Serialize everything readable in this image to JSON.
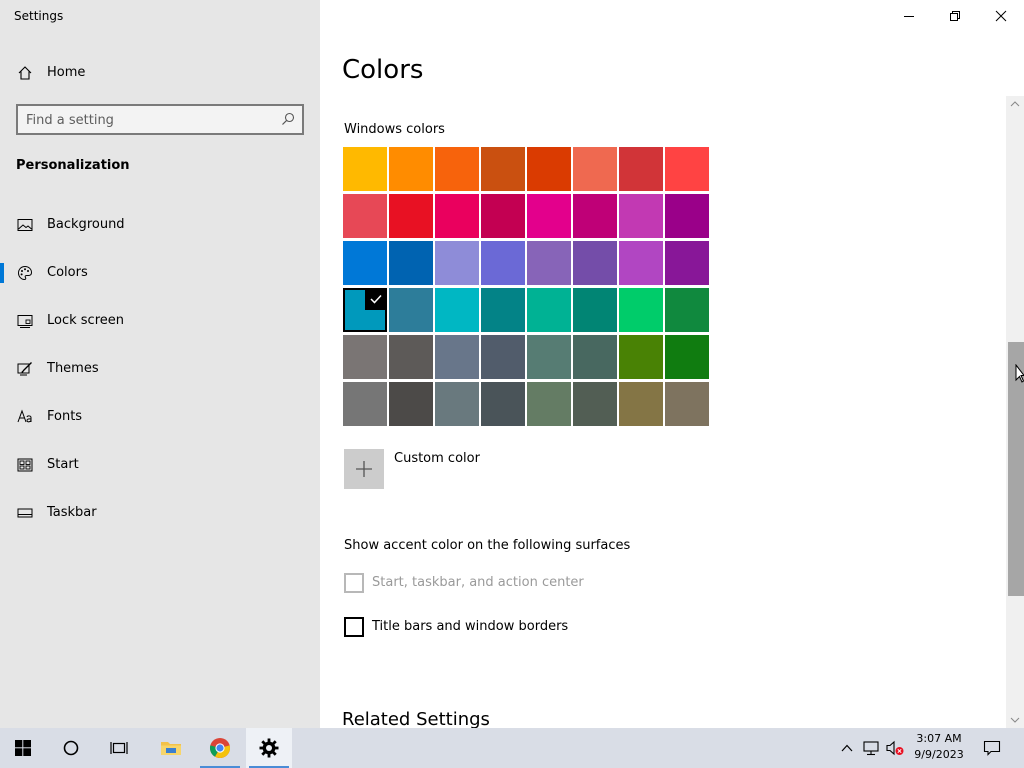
{
  "window": {
    "title": "Settings",
    "controls": [
      "minimize-icon",
      "restore-icon",
      "close-icon"
    ]
  },
  "sidebar": {
    "home_label": "Home",
    "search_placeholder": "Find a setting",
    "section_title": "Personalization",
    "items": [
      {
        "label": "Background",
        "icon": "image-icon"
      },
      {
        "label": "Colors",
        "icon": "palette-icon",
        "active": true
      },
      {
        "label": "Lock screen",
        "icon": "lock-screen-icon"
      },
      {
        "label": "Themes",
        "icon": "themes-icon"
      },
      {
        "label": "Fonts",
        "icon": "fonts-icon"
      },
      {
        "label": "Start",
        "icon": "start-icon"
      },
      {
        "label": "Taskbar",
        "icon": "taskbar-icon"
      }
    ]
  },
  "main": {
    "title": "Colors",
    "windows_colors_label": "Windows colors",
    "palette": [
      [
        "#FFB900",
        "#FF8C00",
        "#F7630C",
        "#CA5010",
        "#DA3B01",
        "#EF6950",
        "#D13438",
        "#FF4343"
      ],
      [
        "#E74856",
        "#E81123",
        "#EA005E",
        "#C30052",
        "#E3008C",
        "#BF0077",
        "#C239B3",
        "#9A0089"
      ],
      [
        "#0078D7",
        "#0063B1",
        "#8E8CD8",
        "#6B69D6",
        "#8764B8",
        "#744DA9",
        "#B146C2",
        "#881798"
      ],
      [
        "#0099BC",
        "#2D7D9A",
        "#00B7C3",
        "#038387",
        "#00B294",
        "#018574",
        "#00CC6A",
        "#10893E"
      ],
      [
        "#7A7574",
        "#5D5A58",
        "#68768A",
        "#515C6B",
        "#567C73",
        "#486860",
        "#498205",
        "#107C10"
      ],
      [
        "#767676",
        "#4C4A48",
        "#69797E",
        "#4A5459",
        "#647C64",
        "#525E54",
        "#847545",
        "#7E735F"
      ]
    ],
    "selected_color": {
      "row": 3,
      "col": 0
    },
    "custom_color_label": "Custom color",
    "accent_heading": "Show accent color on the following surfaces",
    "checkboxes": [
      {
        "label": "Start, taskbar, and action center",
        "checked": false,
        "disabled": true
      },
      {
        "label": "Title bars and window borders",
        "checked": false,
        "disabled": false
      }
    ],
    "related_heading": "Related Settings"
  },
  "taskbar": {
    "buttons": [
      "windows-start-icon",
      "cortana-search-icon",
      "task-view-icon",
      "file-explorer-icon",
      "chrome-icon",
      "settings-gear-icon"
    ],
    "active_button": "settings-gear-icon",
    "tray": [
      "chevron-up-icon",
      "network-icon",
      "volume-muted-icon",
      "action-center-icon"
    ],
    "clock_time": "3:07 AM",
    "clock_date": "9/9/2023"
  }
}
